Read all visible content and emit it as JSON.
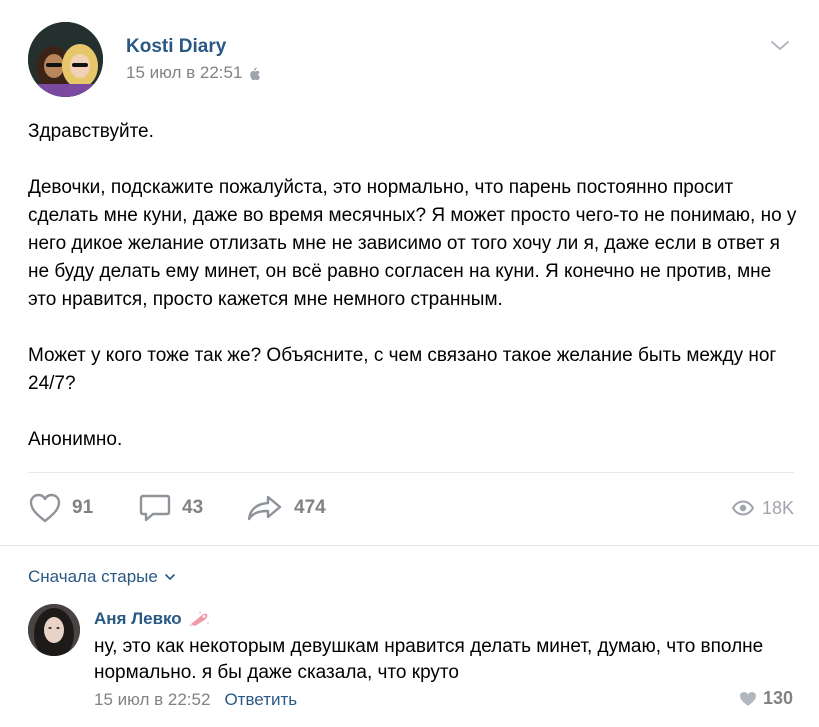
{
  "post": {
    "author": "Kosti Diary",
    "date": "15 июл в 22:51",
    "platform_icon": "apple-icon",
    "paragraphs": [
      "Здравствуйте.",
      "Девочки, подскажите пожалуйста, это нормально, что парень постоянно просит сделать мне куни, даже во время месячных? Я может просто чего-то не понимаю, но у него дикое желание отлизать мне не зависимо от того хочу ли я, даже если в ответ я не буду делать ему минет, он всё равно согласен на куни. Я конечно не против, мне это нравится, просто кажется мне немного странным.",
      "Может у кого тоже так же? Объясните, с чем связано такое желание быть между ног 24/7?",
      "Анонимно."
    ],
    "likes": "91",
    "comments": "43",
    "shares": "474",
    "views": "18K"
  },
  "comments": {
    "sort_label": "Сначала старые",
    "items": [
      {
        "author": "Аня Левко",
        "text": "ну, это как некоторым девушкам нравится делать минет, думаю, что вполне нормально. я бы даже сказала, что круто",
        "date": "15 июл в 22:52",
        "reply_label": "Ответить",
        "likes": "130"
      }
    ]
  },
  "colors": {
    "link": "#2a5885",
    "muted": "#828282",
    "divider": "#e7e8ec"
  }
}
